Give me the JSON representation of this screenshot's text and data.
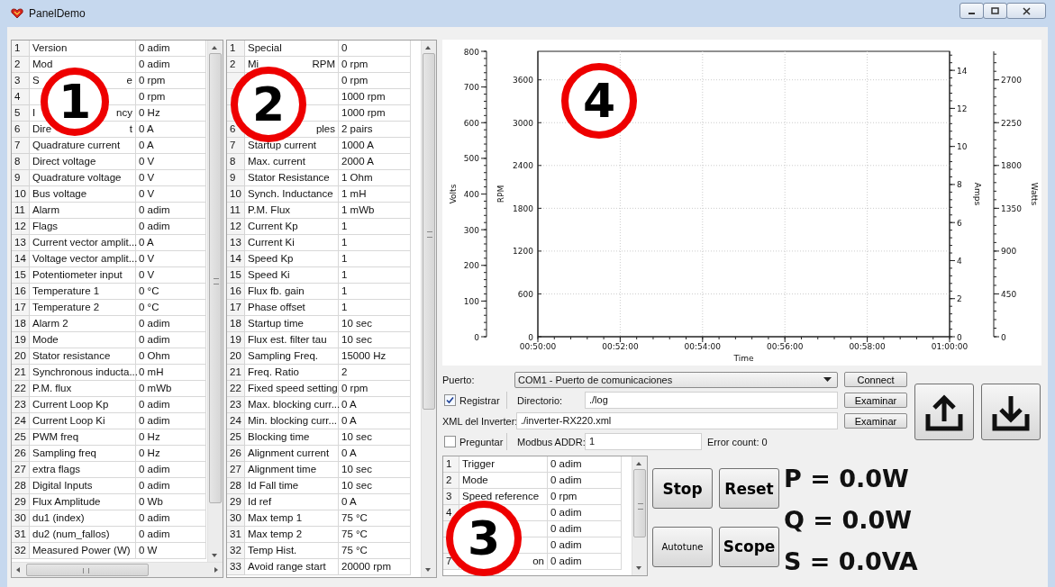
{
  "window": {
    "title": "PanelDemo"
  },
  "table_1": {
    "marker": "1",
    "rows": [
      {
        "number": "1",
        "name": "Version",
        "value": "0 adim"
      },
      {
        "number": "2",
        "name": "Mod",
        "value": "0 adim"
      },
      {
        "number": "3",
        "name": "S",
        "name_tail": "e",
        "value": "0 rpm"
      },
      {
        "number": "4",
        "value": "0 rpm"
      },
      {
        "number": "5",
        "name": "I",
        "name_tail": "ncy",
        "value": "0 Hz"
      },
      {
        "number": "6",
        "name": "Dire",
        "name_tail": "t",
        "value": "0 A"
      },
      {
        "number": "7",
        "name": "Quadrature current",
        "value": "0 A"
      },
      {
        "number": "8",
        "name": "Direct voltage",
        "value": "0 V"
      },
      {
        "number": "9",
        "name": "Quadrature voltage",
        "value": "0 V"
      },
      {
        "number": "10",
        "name": "Bus voltage",
        "value": "0 V"
      },
      {
        "number": "11",
        "name": "Alarm",
        "value": "0 adim"
      },
      {
        "number": "12",
        "name": "Flags",
        "value": "0 adim"
      },
      {
        "number": "13",
        "name": "Current vector amplit...",
        "value": "0 A"
      },
      {
        "number": "14",
        "name": "Voltage vector amplit...",
        "value": "0 V"
      },
      {
        "number": "15",
        "name": "Potentiometer input",
        "value": "0 V"
      },
      {
        "number": "16",
        "name": "Temperature 1",
        "value": "0 °C"
      },
      {
        "number": "17",
        "name": "Temperature 2",
        "value": "0 °C"
      },
      {
        "number": "18",
        "name": "Alarm 2",
        "value": "0 adim"
      },
      {
        "number": "19",
        "name": "Mode",
        "value": "0 adim"
      },
      {
        "number": "20",
        "name": "Stator resistance",
        "value": "0 Ohm"
      },
      {
        "number": "21",
        "name": "Synchronous inducta...",
        "value": "0 mH"
      },
      {
        "number": "22",
        "name": "P.M. flux",
        "value": "0 mWb"
      },
      {
        "number": "23",
        "name": "Current Loop Kp",
        "value": "0 adim"
      },
      {
        "number": "24",
        "name": "Current Loop Ki",
        "value": "0 adim"
      },
      {
        "number": "25",
        "name": "PWM freq",
        "value": "0 Hz"
      },
      {
        "number": "26",
        "name": "Sampling freq",
        "value": "0 Hz"
      },
      {
        "number": "27",
        "name": "extra flags",
        "value": "0 adim"
      },
      {
        "number": "28",
        "name": "Digital Inputs",
        "value": "0 adim"
      },
      {
        "number": "29",
        "name": "Flux Amplitude",
        "value": "0 Wb"
      },
      {
        "number": "30",
        "name": "du1 (index)",
        "value": "0 adim"
      },
      {
        "number": "31",
        "name": "du2 (num_fallos)",
        "value": "0 adim"
      },
      {
        "number": "32",
        "name": "Measured Power (W)",
        "value": "0 W"
      }
    ]
  },
  "table_2": {
    "marker": "2",
    "rows": [
      {
        "number": "1",
        "name": "Special",
        "value": "0"
      },
      {
        "number": "2",
        "name": "Mi",
        "name_tail": "RPM",
        "value": "0 rpm"
      },
      {
        "value": "0 rpm"
      },
      {
        "value": "1000 rpm"
      },
      {
        "value": "1000 rpm"
      },
      {
        "number": "6",
        "name_tail": "ples",
        "value": "2 pairs"
      },
      {
        "number": "7",
        "name": "Startup current",
        "value": "1000 A"
      },
      {
        "number": "8",
        "name": "Max. current",
        "value": "2000 A"
      },
      {
        "number": "9",
        "name": "Stator Resistance",
        "value": "1 Ohm"
      },
      {
        "number": "10",
        "name": "Synch. Inductance",
        "value": "1 mH"
      },
      {
        "number": "11",
        "name": "P.M. Flux",
        "value": "1 mWb"
      },
      {
        "number": "12",
        "name": "Current Kp",
        "value": "1"
      },
      {
        "number": "13",
        "name": "Current Ki",
        "value": "1"
      },
      {
        "number": "14",
        "name": "Speed Kp",
        "value": "1"
      },
      {
        "number": "15",
        "name": "Speed Ki",
        "value": "1"
      },
      {
        "number": "16",
        "name": "Flux fb. gain",
        "value": "1"
      },
      {
        "number": "17",
        "name": "Phase offset",
        "value": "1"
      },
      {
        "number": "18",
        "name": "Startup time",
        "value": "10 sec"
      },
      {
        "number": "19",
        "name": "Flux est. filter tau",
        "value": "10 sec"
      },
      {
        "number": "20",
        "name": "Sampling Freq.",
        "value": "15000 Hz"
      },
      {
        "number": "21",
        "name": "Freq. Ratio",
        "value": "2"
      },
      {
        "number": "22",
        "name": "Fixed speed setting",
        "value": "0 rpm"
      },
      {
        "number": "23",
        "name": "Max. blocking curr...",
        "value": "0 A"
      },
      {
        "number": "24",
        "name": "Min. blocking curr...",
        "value": "0 A"
      },
      {
        "number": "25",
        "name": "Blocking time",
        "value": "10 sec"
      },
      {
        "number": "26",
        "name": "Alignment current",
        "value": "0 A"
      },
      {
        "number": "27",
        "name": "Alignment time",
        "value": "10 sec"
      },
      {
        "number": "28",
        "name": "Id Fall time",
        "value": "10 sec"
      },
      {
        "number": "29",
        "name": "Id ref",
        "value": "0 A"
      },
      {
        "number": "30",
        "name": "Max temp 1",
        "value": "75 °C"
      },
      {
        "number": "31",
        "name": "Max temp 2",
        "value": "75 °C"
      },
      {
        "number": "32",
        "name": "Temp Hist.",
        "value": "75 °C"
      },
      {
        "number": "33",
        "name": "Avoid range start",
        "value": "20000 rpm"
      }
    ]
  },
  "chart": {
    "marker": "4",
    "chart_data": {
      "type": "line",
      "xlabel": "Time",
      "ylabel": "RPM",
      "categories": [
        "00:50:00",
        "00:52:00",
        "00:54:00",
        "00:56:00",
        "00:58:00",
        "01:00:00"
      ],
      "ylim": [
        0,
        4000
      ],
      "yticks": [
        0,
        600,
        1200,
        1800,
        2400,
        3000,
        3600
      ],
      "grid": true
    },
    "extra_axes": [
      {
        "label": "Volts",
        "ticks": [
          "800",
          "700",
          "600",
          "500",
          "400",
          "300",
          "200",
          "100",
          "0"
        ]
      },
      {
        "label": "Amps",
        "ticks": [
          "14",
          "12",
          "10",
          "8",
          "6",
          "4",
          "2",
          "0"
        ]
      },
      {
        "label": "Watts",
        "ticks": [
          "2700",
          "2250",
          "1800",
          "1350",
          "900",
          "450",
          "0"
        ]
      }
    ]
  },
  "connection": {
    "port_label": "Puerto:",
    "port_value": "COM1 - Puerto de comunicaciones",
    "connect_button": "Connect",
    "log": {
      "label": "Registrar",
      "checked": true
    },
    "directory_label": "Directorio:",
    "directory_value": "./log",
    "browse_button_1": "Examinar",
    "xml_label": "XML del Inverter:",
    "xml_value": "./inverter-RX220.xml",
    "browse_button_2": "Examinar",
    "ask": {
      "label": "Preguntar",
      "checked": false
    },
    "modbus_label": "Modbus ADDR:",
    "modbus_value": "1",
    "error_count": "Error count: 0"
  },
  "table_3": {
    "marker": "3",
    "rows": [
      {
        "number": "1",
        "name": "Trigger",
        "value": "0 adim"
      },
      {
        "number": "2",
        "name": "Mode",
        "value": "0 adim"
      },
      {
        "number": "3",
        "name": "Speed reference",
        "value": "0 rpm"
      },
      {
        "number": "4",
        "value": "0 adim"
      },
      {
        "value": "0 adim"
      },
      {
        "value": "0 adim"
      },
      {
        "number": "7",
        "name_tail": "on",
        "value": "0 adim"
      }
    ]
  },
  "actions": [
    {
      "label": "Stop",
      "kind": "large"
    },
    {
      "label": "Reset",
      "kind": "large"
    },
    {
      "label": "Autotune",
      "kind": "small"
    },
    {
      "label": "Scope",
      "kind": "large"
    }
  ],
  "readouts": [
    "P = 0.0W",
    "Q = 0.0W",
    "S = 0.0VA"
  ]
}
